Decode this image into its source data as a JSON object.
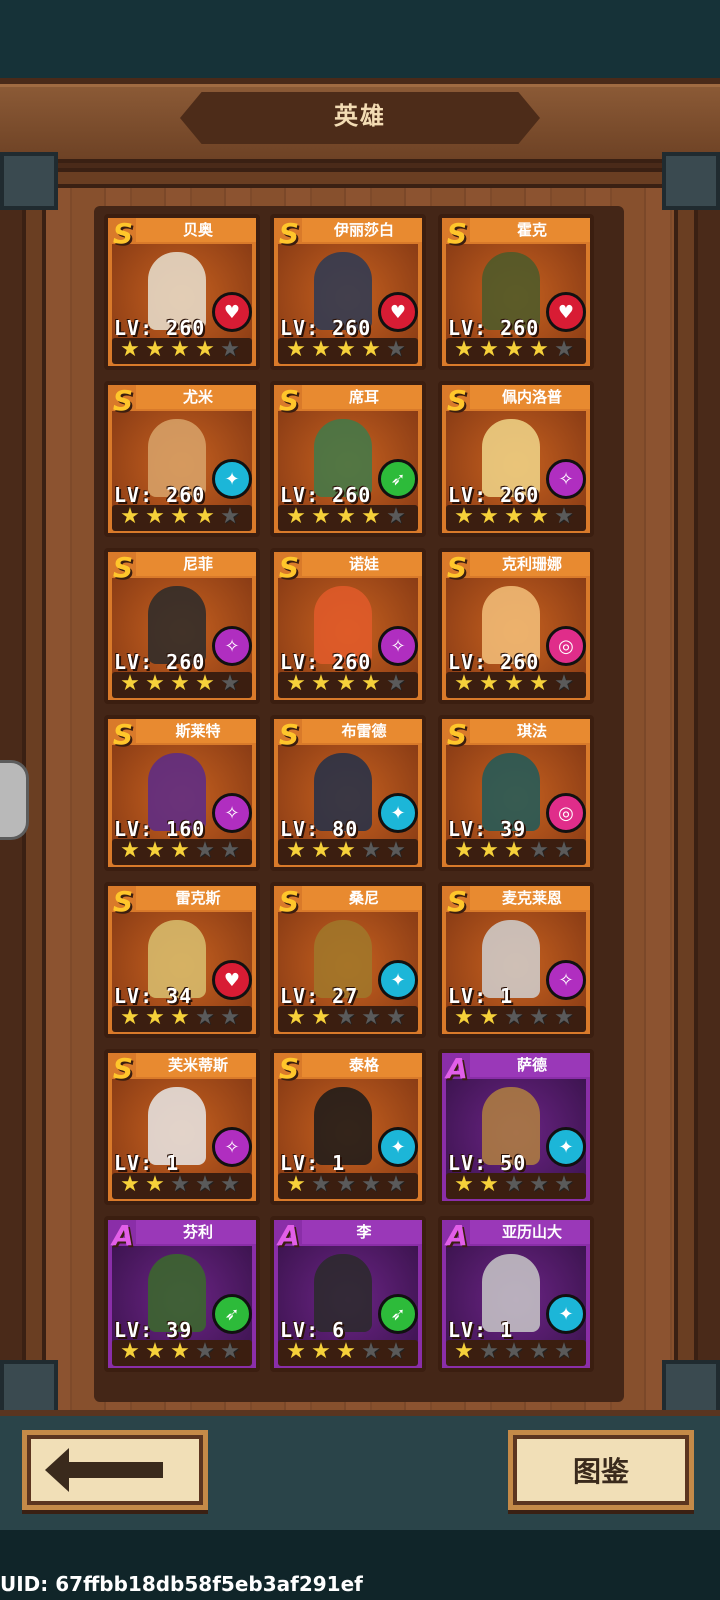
{
  "header": {
    "title": "英雄"
  },
  "buttons": {
    "back_icon": "back-arrow-icon",
    "atlas_label": "图鉴"
  },
  "uid": "UID: 67ffbb18db58f5eb3af291ef",
  "class_colors": {
    "red": "#d81c34",
    "cyan": "#1cb6d8",
    "green": "#2dbb3a",
    "magenta": "#b02ec0",
    "pink": "#e02d8a"
  },
  "heroes": [
    {
      "name": "贝奥",
      "rank": "S",
      "level": "LV: 260",
      "stars": 4,
      "class_icon": "heart-icon",
      "class_color": "#d81c34"
    },
    {
      "name": "伊丽莎白",
      "rank": "S",
      "level": "LV: 260",
      "stars": 4,
      "class_icon": "heart-icon",
      "class_color": "#d81c34"
    },
    {
      "name": "霍克",
      "rank": "S",
      "level": "LV: 260",
      "stars": 4,
      "class_icon": "heart-icon",
      "class_color": "#d81c34"
    },
    {
      "name": "尤米",
      "rank": "S",
      "level": "LV: 260",
      "stars": 4,
      "class_icon": "staff-icon",
      "class_color": "#1cb6d8"
    },
    {
      "name": "席耳",
      "rank": "S",
      "level": "LV: 260",
      "stars": 4,
      "class_icon": "bow-icon",
      "class_color": "#2dbb3a"
    },
    {
      "name": "佩内洛普",
      "rank": "S",
      "level": "LV: 260",
      "stars": 4,
      "class_icon": "wand-icon",
      "class_color": "#b02ec0"
    },
    {
      "name": "尼菲",
      "rank": "S",
      "level": "LV: 260",
      "stars": 4,
      "class_icon": "wand-icon",
      "class_color": "#b02ec0"
    },
    {
      "name": "诺娃",
      "rank": "S",
      "level": "LV: 260",
      "stars": 4,
      "class_icon": "wand-icon",
      "class_color": "#b02ec0"
    },
    {
      "name": "克利珊娜",
      "rank": "S",
      "level": "LV: 260",
      "stars": 4,
      "class_icon": "target-icon",
      "class_color": "#e02d8a"
    },
    {
      "name": "斯莱特",
      "rank": "S",
      "level": "LV: 160",
      "stars": 3,
      "class_icon": "wand-icon",
      "class_color": "#b02ec0"
    },
    {
      "name": "布雷德",
      "rank": "S",
      "level": "LV: 80",
      "stars": 3,
      "class_icon": "staff-icon",
      "class_color": "#1cb6d8"
    },
    {
      "name": "琪法",
      "rank": "S",
      "level": "LV: 39",
      "stars": 3,
      "class_icon": "target-icon",
      "class_color": "#e02d8a"
    },
    {
      "name": "雷克斯",
      "rank": "S",
      "level": "LV: 34",
      "stars": 3,
      "class_icon": "heart-icon",
      "class_color": "#d81c34"
    },
    {
      "name": "桑尼",
      "rank": "S",
      "level": "LV: 27",
      "stars": 2,
      "class_icon": "staff-icon",
      "class_color": "#1cb6d8"
    },
    {
      "name": "麦克莱恩",
      "rank": "S",
      "level": "LV: 1",
      "stars": 2,
      "class_icon": "wand-icon",
      "class_color": "#b02ec0"
    },
    {
      "name": "芙米蒂斯",
      "rank": "S",
      "level": "LV: 1",
      "stars": 2,
      "class_icon": "wand-icon",
      "class_color": "#b02ec0"
    },
    {
      "name": "泰格",
      "rank": "S",
      "level": "LV: 1",
      "stars": 1,
      "class_icon": "staff-icon",
      "class_color": "#1cb6d8"
    },
    {
      "name": "萨德",
      "rank": "A",
      "level": "LV: 50",
      "stars": 2,
      "class_icon": "staff-icon",
      "class_color": "#1cb6d8"
    },
    {
      "name": "芬利",
      "rank": "A",
      "level": "LV: 39",
      "stars": 3,
      "class_icon": "bow-icon",
      "class_color": "#2dbb3a"
    },
    {
      "name": "李",
      "rank": "A",
      "level": "LV: 6",
      "stars": 3,
      "class_icon": "bow-icon",
      "class_color": "#2dbb3a"
    },
    {
      "name": "亚历山大",
      "rank": "A",
      "level": "LV: 1",
      "stars": 1,
      "class_icon": "staff-icon",
      "class_color": "#1cb6d8"
    }
  ]
}
